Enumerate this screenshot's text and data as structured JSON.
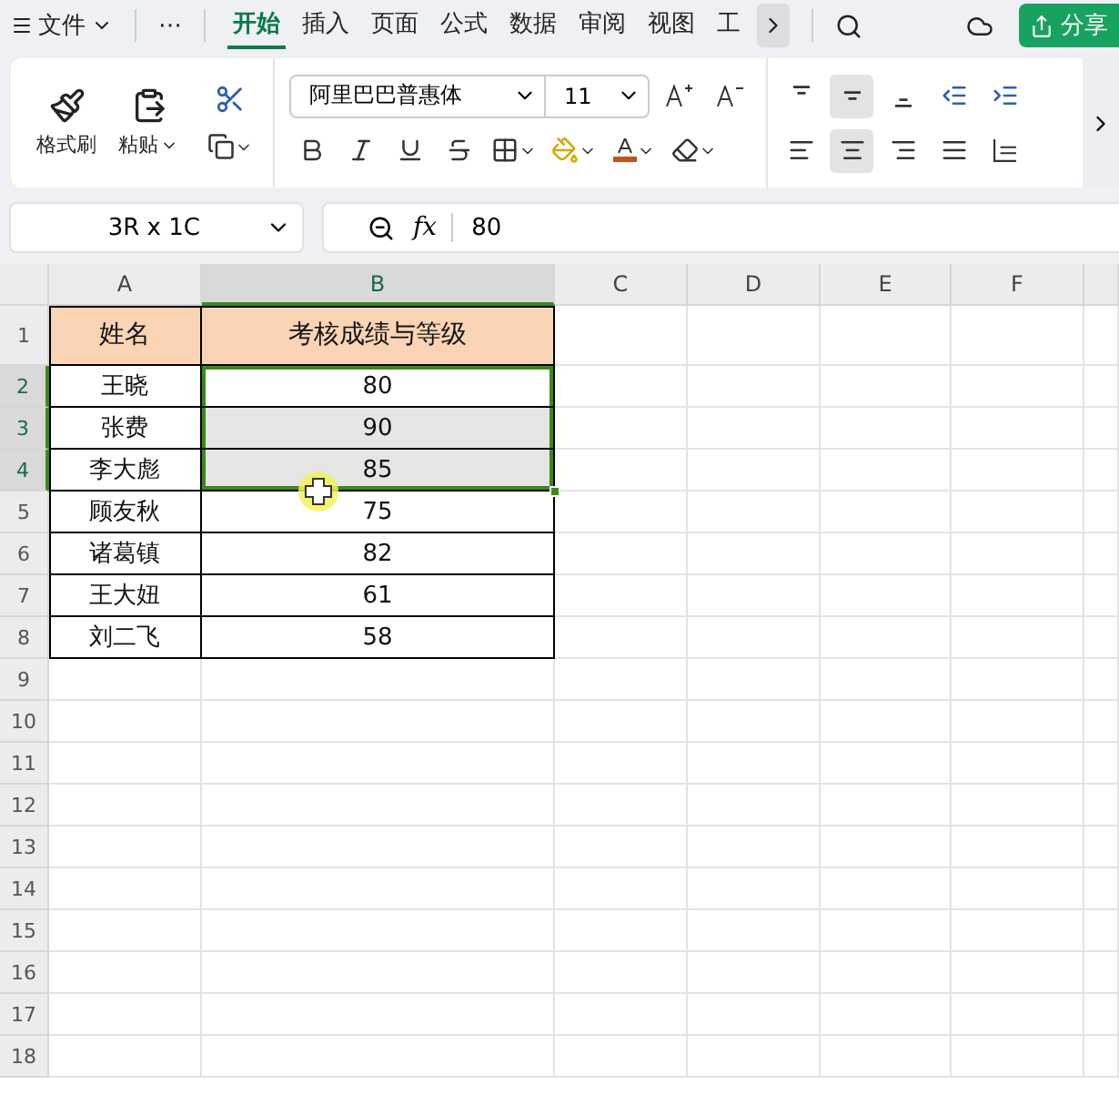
{
  "menu": {
    "file": "文件",
    "more": "⋯",
    "share": "分享"
  },
  "tabs": [
    {
      "label": "开始",
      "selected": true
    },
    {
      "label": "插入",
      "selected": false
    },
    {
      "label": "页面",
      "selected": false
    },
    {
      "label": "公式",
      "selected": false
    },
    {
      "label": "数据",
      "selected": false
    },
    {
      "label": "审阅",
      "selected": false
    },
    {
      "label": "视图",
      "selected": false
    },
    {
      "label": "工",
      "selected": false
    }
  ],
  "ribbon": {
    "format_painter": "格式刷",
    "paste": "粘贴",
    "font_name": "阿里巴巴普惠体",
    "font_size": "11",
    "align_buttons": [
      {
        "selected": false
      },
      {
        "selected": true
      },
      {
        "selected": false
      },
      {
        "selected": false
      },
      {
        "selected": false
      },
      {
        "selected": false
      },
      {
        "selected": true
      },
      {
        "selected": false
      },
      {
        "selected": false
      },
      {
        "selected": false
      }
    ]
  },
  "name_box": "3R x 1C",
  "formula_bar": {
    "fx": "fx",
    "value": "80"
  },
  "columns": [
    {
      "label": "A",
      "selected": false
    },
    {
      "label": "B",
      "selected": true
    },
    {
      "label": "C",
      "selected": false
    },
    {
      "label": "D",
      "selected": false
    },
    {
      "label": "E",
      "selected": false
    },
    {
      "label": "F",
      "selected": false
    }
  ],
  "rows": [
    {
      "number": "1",
      "selected": false,
      "kind": "header",
      "cells": [
        "姓名",
        "考核成绩与等级"
      ],
      "cell_selected": false,
      "active": false
    },
    {
      "number": "2",
      "selected": true,
      "kind": "data",
      "cells": [
        "王晓",
        "80"
      ],
      "cell_selected": true,
      "active": true
    },
    {
      "number": "3",
      "selected": true,
      "kind": "data",
      "cells": [
        "张费",
        "90"
      ],
      "cell_selected": true,
      "active": false
    },
    {
      "number": "4",
      "selected": true,
      "kind": "data",
      "cells": [
        "李大彪",
        "85"
      ],
      "cell_selected": true,
      "active": false
    },
    {
      "number": "5",
      "selected": false,
      "kind": "data",
      "cells": [
        "顾友秋",
        "75"
      ],
      "cell_selected": false,
      "active": false
    },
    {
      "number": "6",
      "selected": false,
      "kind": "data",
      "cells": [
        "诸葛镇",
        "82"
      ],
      "cell_selected": false,
      "active": false
    },
    {
      "number": "7",
      "selected": false,
      "kind": "data",
      "cells": [
        "王大妞",
        "61"
      ],
      "cell_selected": false,
      "active": false
    },
    {
      "number": "8",
      "selected": false,
      "kind": "data",
      "cells": [
        "刘二飞",
        "58"
      ],
      "cell_selected": false,
      "active": false
    },
    {
      "number": "9",
      "selected": false,
      "kind": "empty",
      "cells": []
    },
    {
      "number": "10",
      "selected": false,
      "kind": "empty",
      "cells": []
    },
    {
      "number": "11",
      "selected": false,
      "kind": "empty",
      "cells": []
    },
    {
      "number": "12",
      "selected": false,
      "kind": "empty",
      "cells": []
    },
    {
      "number": "13",
      "selected": false,
      "kind": "empty",
      "cells": []
    },
    {
      "number": "14",
      "selected": false,
      "kind": "empty",
      "cells": []
    },
    {
      "number": "15",
      "selected": false,
      "kind": "empty",
      "cells": []
    },
    {
      "number": "16",
      "selected": false,
      "kind": "empty",
      "cells": []
    },
    {
      "number": "17",
      "selected": false,
      "kind": "empty",
      "cells": []
    },
    {
      "number": "18",
      "selected": false,
      "kind": "empty",
      "cells": []
    }
  ]
}
